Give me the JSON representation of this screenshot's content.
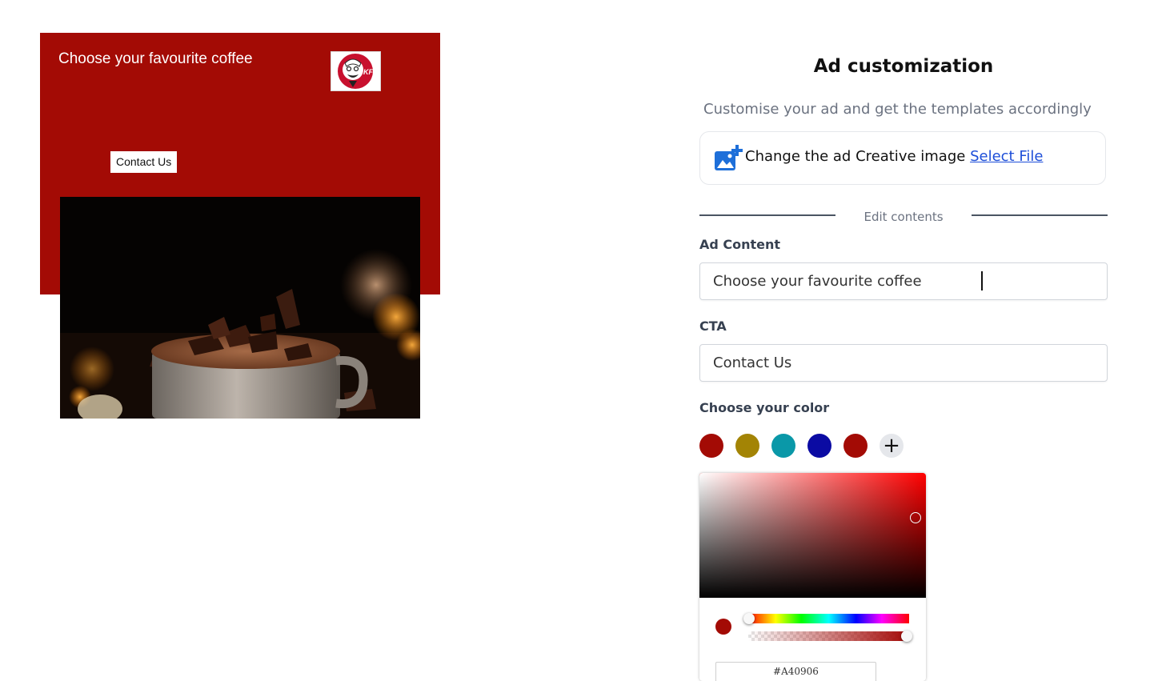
{
  "ad_preview": {
    "headline": "Choose your favourite coffee",
    "cta": "Contact Us",
    "background_color": "#a30b05",
    "logo": {
      "text": "KFC",
      "icon": "kfc-colonel-logo"
    },
    "image": {
      "icon": "hot-chocolate-photo"
    }
  },
  "panel": {
    "title": "Ad customization",
    "subtitle": "Customise your ad and get the templates accordingly",
    "upload": {
      "icon": "add-image-icon",
      "text": "Change the ad Creative image",
      "link": "Select File"
    },
    "divider_text": "Edit contents",
    "ad_content": {
      "label": "Ad Content",
      "value": "Choose your favourite coffee"
    },
    "cta": {
      "label": "CTA",
      "value": "Contact Us"
    },
    "colors": {
      "label": "Choose your color",
      "swatches": [
        "#a30b05",
        "#a38405",
        "#0a98a8",
        "#0b0ba3",
        "#a30b05"
      ],
      "add_icon": "plus-icon"
    },
    "picker": {
      "selected_color": "#a30b05",
      "hex_value": "#A40906",
      "alpha": 1.0
    }
  }
}
